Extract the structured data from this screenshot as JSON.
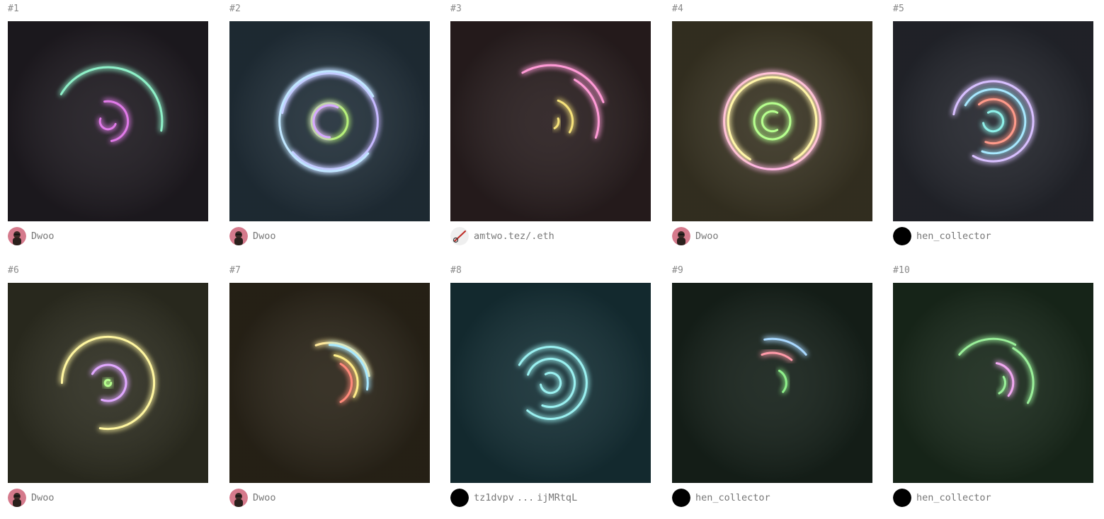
{
  "items": [
    {
      "num": "#1",
      "owner": "Dwoo",
      "avatar": "profile-avatar-icon",
      "bg": "#201c22",
      "arcs": [
        {
          "r": 0.27,
          "start": -150,
          "end": 10,
          "color": "#8ef0c8"
        },
        {
          "r": 0.1,
          "start": -100,
          "end": 80,
          "color": "#e07ae8"
        },
        {
          "r": 0.04,
          "start": 20,
          "end": 200,
          "color": "#e07ae8"
        }
      ]
    },
    {
      "num": "#2",
      "owner": "Dwoo",
      "avatar": "profile-avatar-icon",
      "bg": "#22303a",
      "arcs": [
        {
          "r": 0.24,
          "start": -170,
          "end": 140,
          "color": "#c6b8ff"
        },
        {
          "r": 0.25,
          "start": 40,
          "end": 330,
          "color": "#bfe6ff"
        },
        {
          "r": 0.09,
          "start": 0,
          "end": 360,
          "color": "#b6f07a"
        },
        {
          "r": 0.08,
          "start": 90,
          "end": 300,
          "color": "#d6a8ff"
        }
      ]
    },
    {
      "num": "#3",
      "owner": "amtwo.tez/.eth",
      "avatar": "pen-avatar-icon",
      "bg": "#2a1f20",
      "arcs": [
        {
          "r": 0.28,
          "start": -120,
          "end": -20,
          "color": "#ff9ad6"
        },
        {
          "r": 0.24,
          "start": -60,
          "end": 20,
          "color": "#ff9ad6"
        },
        {
          "r": 0.11,
          "start": -70,
          "end": 30,
          "color": "#f6e27a"
        },
        {
          "r": 0.04,
          "start": -20,
          "end": 60,
          "color": "#f6e27a"
        }
      ]
    },
    {
      "num": "#4",
      "owner": "Dwoo",
      "avatar": "profile-avatar-icon",
      "bg": "#3a3524",
      "arcs": [
        {
          "r": 0.24,
          "start": 0,
          "end": 360,
          "color": "#ffb6e2"
        },
        {
          "r": 0.22,
          "start": 120,
          "end": 420,
          "color": "#fff6a8"
        },
        {
          "r": 0.09,
          "start": 0,
          "end": 360,
          "color": "#b6ff8e"
        },
        {
          "r": 0.05,
          "start": 60,
          "end": 300,
          "color": "#b6ff8e"
        }
      ]
    },
    {
      "num": "#5",
      "owner": "hen_collector",
      "avatar": "black-avatar-icon",
      "bg": "#25272e",
      "arcs": [
        {
          "r": 0.2,
          "start": -170,
          "end": 120,
          "color": "#d8c0ff"
        },
        {
          "r": 0.16,
          "start": -150,
          "end": 110,
          "color": "#a8e8ff"
        },
        {
          "r": 0.11,
          "start": -130,
          "end": 110,
          "color": "#ff9a8a"
        },
        {
          "r": 0.05,
          "start": -120,
          "end": 170,
          "color": "#8ef0e8"
        }
      ]
    },
    {
      "num": "#6",
      "owner": "Dwoo",
      "avatar": "profile-avatar-icon",
      "bg": "#2f2f22",
      "arcs": [
        {
          "r": 0.23,
          "start": -180,
          "end": 100,
          "color": "#fff6a0"
        },
        {
          "r": 0.09,
          "start": -150,
          "end": 110,
          "color": "#e0a8ff"
        },
        {
          "r": 0.015,
          "start": 0,
          "end": 300,
          "color": "#b6ff8e"
        }
      ]
    },
    {
      "num": "#7",
      "owner": "Dwoo",
      "avatar": "profile-avatar-icon",
      "bg": "#2b2519",
      "arcs": [
        {
          "r": 0.2,
          "start": -110,
          "end": -10,
          "color": "#ffe89a"
        },
        {
          "r": 0.19,
          "start": -90,
          "end": 10,
          "color": "#a8e8ff"
        },
        {
          "r": 0.14,
          "start": -80,
          "end": 30,
          "color": "#fff08a"
        },
        {
          "r": 0.11,
          "start": -60,
          "end": 60,
          "color": "#ff8a7a"
        }
      ]
    },
    {
      "num": "#8",
      "owner_left": "tz1dvpv",
      "owner_sep": "...",
      "owner_right": "ijMRtqL",
      "avatar": "black-avatar-icon",
      "bg": "#163036",
      "arcs": [
        {
          "r": 0.18,
          "start": -150,
          "end": 130,
          "color": "#9af0f0"
        },
        {
          "r": 0.12,
          "start": -160,
          "end": 110,
          "color": "#9af0f0"
        },
        {
          "r": 0.05,
          "start": -120,
          "end": 170,
          "color": "#9af0f0"
        }
      ]
    },
    {
      "num": "#9",
      "owner": "hen_collector",
      "avatar": "black-avatar-icon",
      "bg": "#17221b",
      "arcs": [
        {
          "r": 0.22,
          "start": -100,
          "end": -40,
          "color": "#a8d8ff"
        },
        {
          "r": 0.15,
          "start": -110,
          "end": -50,
          "color": "#ff9aa8"
        },
        {
          "r": 0.07,
          "start": -60,
          "end": 40,
          "color": "#8ef08a"
        }
      ]
    },
    {
      "num": "#10",
      "owner": "hen_collector",
      "avatar": "black-avatar-icon",
      "bg": "#1a2a1c",
      "arcs": [
        {
          "r": 0.22,
          "start": -140,
          "end": -60,
          "color": "#9af09a"
        },
        {
          "r": 0.2,
          "start": -60,
          "end": 30,
          "color": "#9af09a"
        },
        {
          "r": 0.1,
          "start": -80,
          "end": 40,
          "color": "#f0a8f0"
        },
        {
          "r": 0.06,
          "start": -30,
          "end": 60,
          "color": "#9af09a"
        }
      ]
    }
  ]
}
